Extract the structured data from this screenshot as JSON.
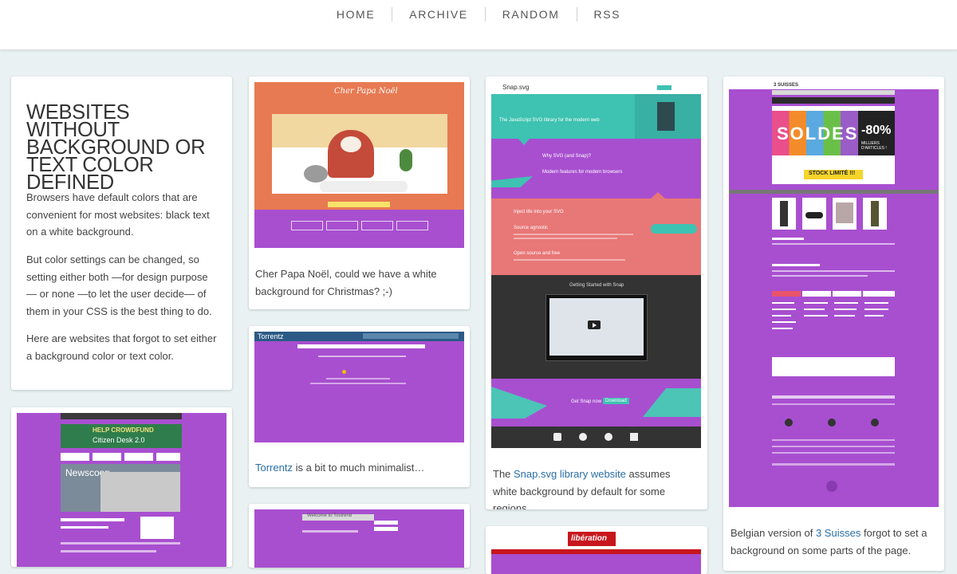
{
  "nav": {
    "items": [
      "HOME",
      "ARCHIVE",
      "RANDOM",
      "RSS"
    ]
  },
  "intro": {
    "title": "WEBSITES WITHOUT BACKGROUND OR TEXT COLOR DEFINED",
    "paragraphs": [
      "Browsers have default colors that are convenient for most websites: black text on a white background.",
      "But color settings can be changed, so setting either both —for design purpose— or none —to let the user decide— of them in your CSS is the best thing to do.",
      "Here are websites that forgot to set either a background color or text color."
    ]
  },
  "posts": {
    "papanoel": {
      "screenshot_title": "Cher Papa Noël",
      "caption": "Cher Papa Noël, could we have a white background for Christmas? ;-)"
    },
    "torrentz": {
      "screenshot_title": "Torrentz",
      "link": "Torrentz",
      "caption_rest": " is a bit to much minimalist…"
    },
    "snapsvg": {
      "screenshot_title": "Snap.svg",
      "caption_before": "The ",
      "link": "Snap.svg library website",
      "caption_after": " assumes white background by default for some regions…",
      "shot_text": {
        "tagline": "The JavaScript SVG library for the modern web",
        "why": "Why SVG (and Snap)?",
        "modern": "Modern features for modern browsers",
        "inject": "Inject life into your SVG",
        "agnostic": "Source agnostic",
        "open": "Open source and free",
        "getting_started": "Getting Started with Snap",
        "get_snap": "Get Snap now",
        "download": "Download"
      }
    },
    "suisses": {
      "screenshot_title": "3 SUISSES",
      "caption_before": "Belgian version of ",
      "link": "3 Suisses",
      "caption_after": " forgot to set a background on some parts of the page.",
      "shot_text": {
        "soldes": "SOLDES",
        "percent": "-80%",
        "milliers": "MILLIERS D'ARTICLES !",
        "stock": "STOCK LIMITÉ !!!"
      }
    },
    "newscoop": {
      "shot_text": {
        "crowdfund": "HELP CROWDFUND",
        "citizen": "Citizen Desk 2.0",
        "brand": "Newscoop"
      }
    },
    "liberation": {
      "shot_text": {
        "logo": "libération"
      }
    },
    "welcome": {
      "shot_text": {
        "heading": "Welcome to Tostrend"
      }
    }
  },
  "colors": {
    "accent": "#a84fd0",
    "background": "#e9f1f2",
    "link": "#2a6ea6",
    "snap_teal": "#3ec2b2",
    "snap_salmon": "#e87777",
    "snap_dark": "#333333"
  },
  "icons": {
    "play": "play-icon",
    "twitter": "twitter-icon",
    "github": "github-icon"
  }
}
